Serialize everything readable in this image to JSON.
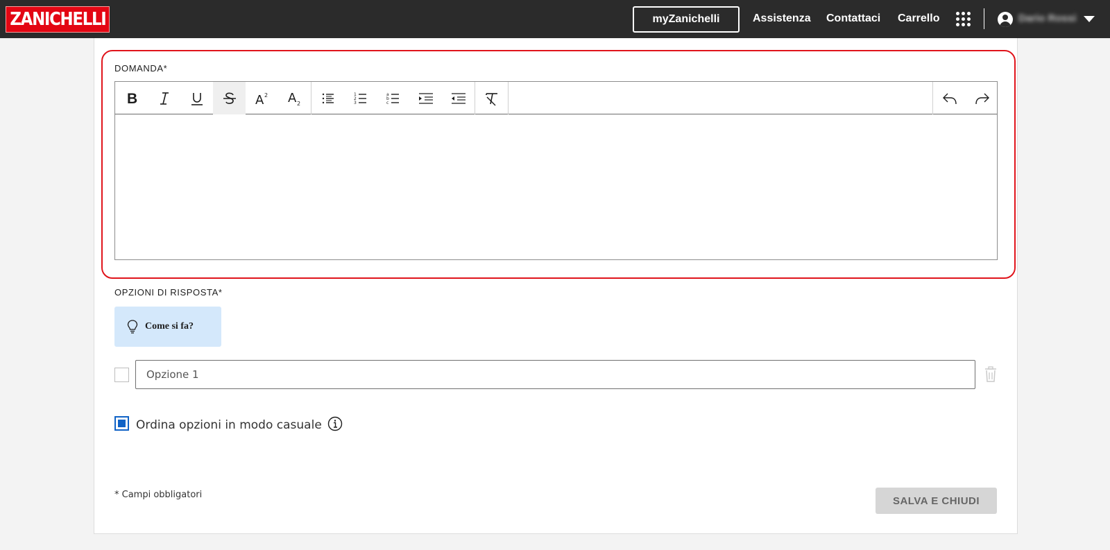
{
  "header": {
    "logo_text": "ZANICHELLI",
    "my_button": "myZanichelli",
    "nav": [
      "Assistenza",
      "Contattaci",
      "Carrello"
    ],
    "user_name": "Dario Rossi",
    "apps_icon": "grid-icon",
    "user_icon": "user-circle-icon"
  },
  "form": {
    "question_label": "DOMANDA*",
    "toolbar": {
      "buttons": [
        "bold",
        "italic",
        "underline",
        "strikethrough",
        "superscript",
        "subscript",
        "bulleted-list",
        "numbered-list",
        "lettered-list",
        "indent",
        "outdent",
        "clear-format",
        "undo",
        "redo"
      ],
      "active": "strikethrough"
    },
    "answers_label": "OPZIONI DI RISPOSTA*",
    "howto_label": "Come si fa?",
    "option_placeholder": "Opzione 1",
    "random_label": "Ordina opzioni in modo casuale",
    "random_checked": true,
    "required_note": "* Campi obbligatori",
    "save_label": "SALVA E CHIUDI"
  },
  "colors": {
    "topbar": "#2b2b2b",
    "brand": "#e30613",
    "highlight": "#e0141b",
    "accent": "#0f62c6",
    "howto_bg": "#d4e8fb"
  }
}
